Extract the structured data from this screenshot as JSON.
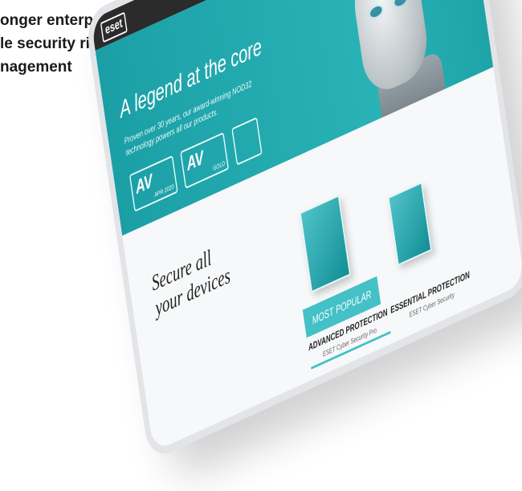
{
  "heading": {
    "line1": "onger enterprise-",
    "line2": "le security risk",
    "line3": "nagement"
  },
  "tablet": {
    "logo": "eset",
    "hero": {
      "title": "A legend at the core",
      "description": "Proven over 30 years, our award-winning NOD32 technology powers all our products.",
      "badges": [
        {
          "label": "AV",
          "sub": "APR 2020"
        },
        {
          "label": "AV",
          "sub": "GOLD"
        },
        {
          "label": "",
          "sub": ""
        }
      ]
    },
    "section2": {
      "title_line1": "Secure all",
      "title_line2": "your devices",
      "most_popular": "MOST POPULAR",
      "plans": [
        {
          "name": "ADVANCED PROTECTION",
          "product": "ESET Cyber Security Pro"
        },
        {
          "name": "ESSENTIAL PROTECTION",
          "product": "ESET Cyber Security"
        }
      ]
    }
  },
  "colors": {
    "accent": "#29b3b6",
    "topbar": "#2b2b2b"
  }
}
